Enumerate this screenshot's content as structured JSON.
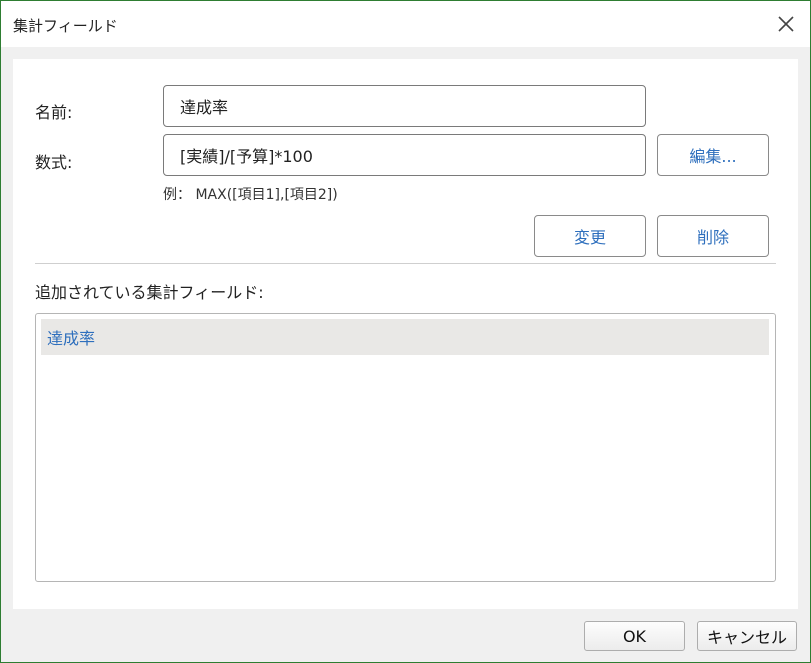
{
  "dialog": {
    "title": "集計フィールド",
    "close_icon": "close-icon"
  },
  "form": {
    "name_label": "名前:",
    "name_value": "達成率",
    "formula_label": "数式:",
    "formula_value": "[実績]/[予算]*100",
    "edit_button": "編集...",
    "example_text": "例： MAX([項目1],[項目2])",
    "change_button": "変更",
    "delete_button": "削除"
  },
  "list": {
    "label": "追加されている集計フィールド:",
    "items": [
      "達成率"
    ]
  },
  "footer": {
    "ok_button": "OK",
    "cancel_button": "キャンセル"
  },
  "colors": {
    "accent_text": "#2e6fbd",
    "window_border": "#2e7d32",
    "selected_row": "#e9e8e6"
  }
}
